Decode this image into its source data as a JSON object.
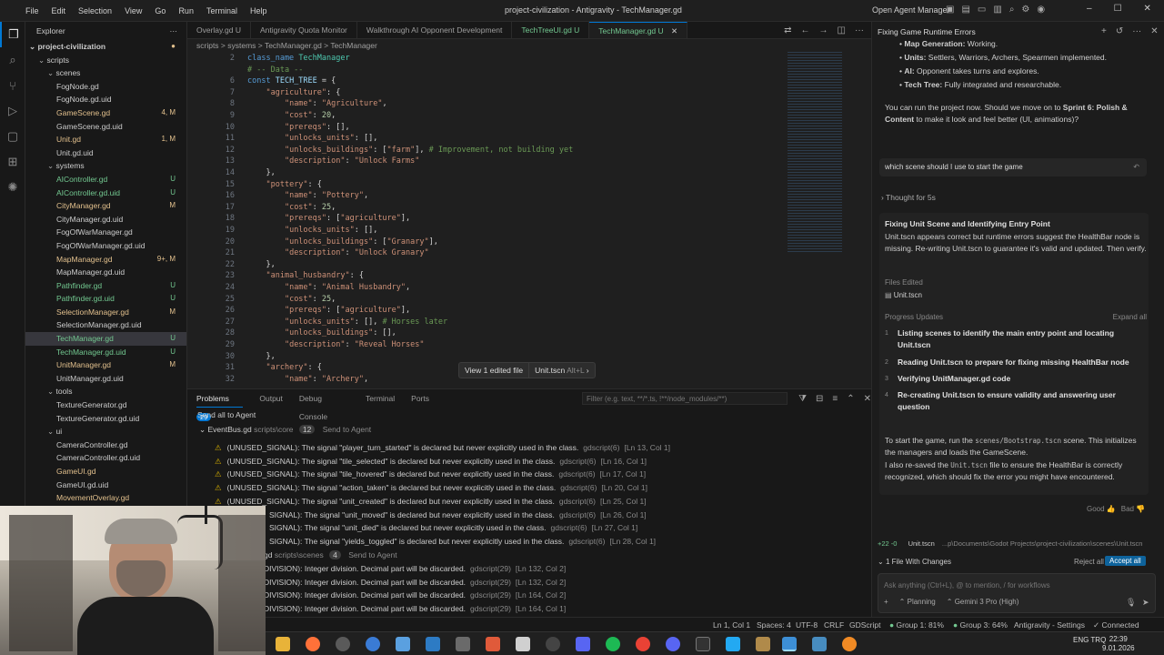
{
  "titlebar": {
    "menus": [
      "File",
      "Edit",
      "Selection",
      "View",
      "Go",
      "Run",
      "Terminal",
      "Help"
    ],
    "title": "project-civilization - Antigravity - TechManager.gd",
    "open_agent_manager": "Open Agent Manager"
  },
  "explorer": {
    "header": "Explorer",
    "project": "project-civilization",
    "items": [
      {
        "label": "scripts",
        "indent": 1,
        "folder": true,
        "badge": ""
      },
      {
        "label": "scenes",
        "indent": 2,
        "folder": true,
        "badge": ""
      },
      {
        "label": "FogNode.gd",
        "indent": 3,
        "badge": "",
        "color": "#cccccc"
      },
      {
        "label": "FogNode.gd.uid",
        "indent": 3,
        "badge": "",
        "color": "#cccccc"
      },
      {
        "label": "GameScene.gd",
        "indent": 3,
        "badge": "4, M",
        "color": "#e2c08d"
      },
      {
        "label": "GameScene.gd.uid",
        "indent": 3,
        "badge": "",
        "color": "#cccccc"
      },
      {
        "label": "Unit.gd",
        "indent": 3,
        "badge": "1, M",
        "color": "#e2c08d"
      },
      {
        "label": "Unit.gd.uid",
        "indent": 3,
        "badge": "",
        "color": "#cccccc"
      },
      {
        "label": "systems",
        "indent": 2,
        "folder": true,
        "badge": ""
      },
      {
        "label": "AIController.gd",
        "indent": 3,
        "badge": "U",
        "color": "#73c991"
      },
      {
        "label": "AIController.gd.uid",
        "indent": 3,
        "badge": "U",
        "color": "#73c991"
      },
      {
        "label": "CityManager.gd",
        "indent": 3,
        "badge": "M",
        "color": "#e2c08d"
      },
      {
        "label": "CityManager.gd.uid",
        "indent": 3,
        "badge": "",
        "color": "#cccccc"
      },
      {
        "label": "FogOfWarManager.gd",
        "indent": 3,
        "badge": "",
        "color": "#cccccc"
      },
      {
        "label": "FogOfWarManager.gd.uid",
        "indent": 3,
        "badge": "",
        "color": "#cccccc"
      },
      {
        "label": "MapManager.gd",
        "indent": 3,
        "badge": "9+, M",
        "color": "#e2c08d"
      },
      {
        "label": "MapManager.gd.uid",
        "indent": 3,
        "badge": "",
        "color": "#cccccc"
      },
      {
        "label": "Pathfinder.gd",
        "indent": 3,
        "badge": "U",
        "color": "#73c991"
      },
      {
        "label": "Pathfinder.gd.uid",
        "indent": 3,
        "badge": "U",
        "color": "#73c991"
      },
      {
        "label": "SelectionManager.gd",
        "indent": 3,
        "badge": "M",
        "color": "#e2c08d"
      },
      {
        "label": "SelectionManager.gd.uid",
        "indent": 3,
        "badge": "",
        "color": "#cccccc"
      },
      {
        "label": "TechManager.gd",
        "indent": 3,
        "badge": "U",
        "color": "#73c991",
        "selected": true
      },
      {
        "label": "TechManager.gd.uid",
        "indent": 3,
        "badge": "U",
        "color": "#73c991"
      },
      {
        "label": "UnitManager.gd",
        "indent": 3,
        "badge": "M",
        "color": "#e2c08d"
      },
      {
        "label": "UnitManager.gd.uid",
        "indent": 3,
        "badge": "",
        "color": "#cccccc"
      },
      {
        "label": "tools",
        "indent": 2,
        "folder": true,
        "badge": ""
      },
      {
        "label": "TextureGenerator.gd",
        "indent": 3,
        "badge": "",
        "color": "#cccccc"
      },
      {
        "label": "TextureGenerator.gd.uid",
        "indent": 3,
        "badge": "",
        "color": "#cccccc"
      },
      {
        "label": "ui",
        "indent": 2,
        "folder": true,
        "badge": ""
      },
      {
        "label": "CameraController.gd",
        "indent": 3,
        "badge": "",
        "color": "#cccccc"
      },
      {
        "label": "CameraController.gd.uid",
        "indent": 3,
        "badge": "",
        "color": "#cccccc"
      },
      {
        "label": "GameUI.gd",
        "indent": 3,
        "badge": "",
        "color": "#e2c08d"
      },
      {
        "label": "GameUI.gd.uid",
        "indent": 3,
        "badge": "",
        "color": "#cccccc"
      },
      {
        "label": "MovementOverlay.gd",
        "indent": 3,
        "badge": "",
        "color": "#e2c08d"
      }
    ]
  },
  "tabs": [
    {
      "label": "Overlay.gd U",
      "active": false
    },
    {
      "label": "Antigravity Quota Monitor",
      "active": false
    },
    {
      "label": "Walkthrough  AI Opponent Development",
      "active": false
    },
    {
      "label": "TechTreeUI.gd U",
      "active": false
    },
    {
      "label": "TechManager.gd U",
      "active": true
    }
  ],
  "breadcrumb": "scripts > systems > TechManager.gd > TechManager",
  "code": {
    "lines": [
      {
        "n": "2",
        "html": "<span class='k'>class_name</span> <span class='t'>TechManager</span>"
      },
      {
        "n": "",
        "html": "<span class='c'># -- Data --</span>"
      },
      {
        "n": "6",
        "html": "<span class='k'>const</span> <span class='p'>TECH_TREE</span> = {"
      },
      {
        "n": "7",
        "html": "    <span class='s'>\"agriculture\"</span>: {"
      },
      {
        "n": "8",
        "html": "        <span class='s'>\"name\"</span>: <span class='s'>\"Agriculture\"</span>,"
      },
      {
        "n": "9",
        "html": "        <span class='s'>\"cost\"</span>: <span class='n'>20</span>,"
      },
      {
        "n": "10",
        "html": "        <span class='s'>\"prereqs\"</span>: [],"
      },
      {
        "n": "11",
        "html": "        <span class='s'>\"unlocks_units\"</span>: [],"
      },
      {
        "n": "12",
        "html": "        <span class='s'>\"unlocks_buildings\"</span>: [<span class='s'>\"farm\"</span>], <span class='c'># Improvement, not building yet</span>"
      },
      {
        "n": "13",
        "html": "        <span class='s'>\"description\"</span>: <span class='s'>\"Unlock Farms\"</span>"
      },
      {
        "n": "14",
        "html": "    },"
      },
      {
        "n": "15",
        "html": "    <span class='s'>\"pottery\"</span>: {"
      },
      {
        "n": "16",
        "html": "        <span class='s'>\"name\"</span>: <span class='s'>\"Pottery\"</span>,"
      },
      {
        "n": "17",
        "html": "        <span class='s'>\"cost\"</span>: <span class='n'>25</span>,"
      },
      {
        "n": "18",
        "html": "        <span class='s'>\"prereqs\"</span>: [<span class='s'>\"agriculture\"</span>],"
      },
      {
        "n": "19",
        "html": "        <span class='s'>\"unlocks_units\"</span>: [],"
      },
      {
        "n": "20",
        "html": "        <span class='s'>\"unlocks_buildings\"</span>: [<span class='s'>\"Granary\"</span>],"
      },
      {
        "n": "21",
        "html": "        <span class='s'>\"description\"</span>: <span class='s'>\"Unlock Granary\"</span>"
      },
      {
        "n": "22",
        "html": "    },"
      },
      {
        "n": "23",
        "html": "    <span class='s'>\"animal_husbandry\"</span>: {"
      },
      {
        "n": "24",
        "html": "        <span class='s'>\"name\"</span>: <span class='s'>\"Animal Husbandry\"</span>,"
      },
      {
        "n": "25",
        "html": "        <span class='s'>\"cost\"</span>: <span class='n'>25</span>,"
      },
      {
        "n": "26",
        "html": "        <span class='s'>\"prereqs\"</span>: [<span class='s'>\"agriculture\"</span>],"
      },
      {
        "n": "27",
        "html": "        <span class='s'>\"unlocks_units\"</span>: [], <span class='c'># Horses later</span>"
      },
      {
        "n": "28",
        "html": "        <span class='s'>\"unlocks_buildings\"</span>: [],"
      },
      {
        "n": "29",
        "html": "        <span class='s'>\"description\"</span>: <span class='s'>\"Reveal Horses\"</span>"
      },
      {
        "n": "30",
        "html": "    },"
      },
      {
        "n": "31",
        "html": "    <span class='s'>\"archery\"</span>: {"
      },
      {
        "n": "32",
        "html": "        <span class='s'>\"name\"</span>: <span class='s'>\"Archery\"</span>,"
      }
    ]
  },
  "review": {
    "view_edited": "View 1 edited file",
    "file": "Unit.tscn",
    "shortcut": "Alt+L"
  },
  "panel": {
    "tabs": [
      "Problems",
      "Output",
      "Debug Console",
      "Terminal",
      "Ports"
    ],
    "problems_count": "29",
    "filter_placeholder": "Filter (e.g. text, **/*.ts, !**/node_modules/**)",
    "send_all": "Send all to Agent",
    "group1": {
      "file": "EventBus.gd",
      "path": "scripts\\core",
      "count": "12",
      "send": "Send to Agent"
    },
    "warnings": [
      {
        "msg": "(UNUSED_SIGNAL): The signal \"player_turn_started\" is declared but never explicitly used in the class.",
        "src": "gdscript(6)",
        "loc": "[Ln 13, Col 1]"
      },
      {
        "msg": "(UNUSED_SIGNAL): The signal \"tile_selected\" is declared but never explicitly used in the class.",
        "src": "gdscript(6)",
        "loc": "[Ln 16, Col 1]"
      },
      {
        "msg": "(UNUSED_SIGNAL): The signal \"tile_hovered\" is declared but never explicitly used in the class.",
        "src": "gdscript(6)",
        "loc": "[Ln 17, Col 1]"
      },
      {
        "msg": "(UNUSED_SIGNAL): The signal \"action_taken\" is declared but never explicitly used in the class.",
        "src": "gdscript(6)",
        "loc": "[Ln 20, Col 1]"
      },
      {
        "msg": "(UNUSED_SIGNAL): The signal \"unit_created\" is declared but never explicitly used in the class.",
        "src": "gdscript(6)",
        "loc": "[Ln 25, Col 1]"
      },
      {
        "msg": "SIGNAL): The signal \"unit_moved\" is declared but never explicitly used in the class.",
        "src": "gdscript(6)",
        "loc": "[Ln 26, Col 1]"
      },
      {
        "msg": "SIGNAL): The signal \"unit_died\" is declared but never explicitly used in the class.",
        "src": "gdscript(6)",
        "loc": "[Ln 27, Col 1]"
      },
      {
        "msg": "SIGNAL): The signal \"yields_toggled\" is declared but never explicitly used in the class.",
        "src": "gdscript(6)",
        "loc": "[Ln 28, Col 1]"
      }
    ],
    "group2": {
      "file": "gd",
      "path": "scripts\\scenes",
      "count": "4",
      "send": "Send to Agent"
    },
    "errors": [
      {
        "msg": "DIVISION): Integer division. Decimal part will be discarded.",
        "src": "gdscript(29)",
        "loc": "[Ln 132, Col 2]"
      },
      {
        "msg": "DIVISION): Integer division. Decimal part will be discarded.",
        "src": "gdscript(29)",
        "loc": "[Ln 132, Col 2]"
      },
      {
        "msg": "DIVISION): Integer division. Decimal part will be discarded.",
        "src": "gdscript(29)",
        "loc": "[Ln 164, Col 2]"
      },
      {
        "msg": "DIVISION): Integer division. Decimal part will be discarded.",
        "src": "gdscript(29)",
        "loc": "[Ln 164, Col 1]"
      }
    ]
  },
  "agent": {
    "title": "Fixing Game Runtime Errors",
    "bullets": [
      {
        "b": "Map Generation:",
        "t": " Working."
      },
      {
        "b": "Units:",
        "t": " Settlers, Warriors, Archers, Spearmen implemented."
      },
      {
        "b": "AI:",
        "t": " Opponent takes turns and explores."
      },
      {
        "b": "Tech Tree:",
        "t": " Fully integrated and researchable."
      }
    ],
    "para1a": "You can run the project now. Should we move on to ",
    "para1b": "Sprint 6: Polish & Content",
    "para1c": " to make it look and feel better (UI, animations)?",
    "user_msg": "which scene should I use to start the game",
    "thought": "Thought for 5s",
    "step_title": "Fixing Unit Scene and Identifying Entry Point",
    "step_body": "Unit.tscn appears correct but runtime errors suggest the HealthBar node is missing. Re-writing Unit.tscn to guarantee it's valid and updated. Then verify.",
    "files_edited_label": "Files Edited",
    "file_edited": "Unit.tscn",
    "progress_label": "Progress Updates",
    "expand_all": "Expand all",
    "progress": [
      {
        "n": "1",
        "t": "Listing scenes to identify the main entry point and locating Unit.tscn"
      },
      {
        "n": "2",
        "t": "Reading Unit.tscn to prepare for fixing missing HealthBar node"
      },
      {
        "n": "3",
        "t": "Verifying UnitManager.gd code"
      },
      {
        "n": "4",
        "t": "Re-creating Unit.tscn to ensure validity and answering user question"
      }
    ],
    "answer1a": "To start the game, run the ",
    "answer1code": "scenes/Bootstrap.tscn",
    "answer1b": " scene. This initializes the managers and loads the GameScene.",
    "answer2a": "I also re-saved the ",
    "answer2code": "Unit.tscn",
    "answer2b": " file to ensure the HealthBar is correctly recognized, which should fix the error you might have encountered.",
    "good": "Good",
    "bad": "Bad",
    "change_file": "Unit.tscn",
    "change_stats": "+22 -0",
    "change_path": "...p\\Documents\\Godot Projects\\project-civilization\\scenes\\Unit.tscn",
    "files_with_changes": "1 File With Changes",
    "reject_all": "Reject all",
    "accept_all": "Accept all",
    "input_placeholder": "Ask anything (Ctrl+L), @ to mention, / for workflows",
    "mode": "Planning",
    "model": "Gemini 3 Pro (High)"
  },
  "status": {
    "pos": "Ln 1, Col 1",
    "spaces": "Spaces: 4",
    "enc": "UTF-8",
    "eol": "CRLF",
    "lang": "GDScript",
    "g1": "Group 1: 81%",
    "g3": "Group 3: 64%",
    "settings": "Antigravity - Settings",
    "connected": "Connected"
  },
  "taskbar": {
    "time": "22:39",
    "date": "9.01.2026",
    "lang": "ENG TRQ"
  }
}
